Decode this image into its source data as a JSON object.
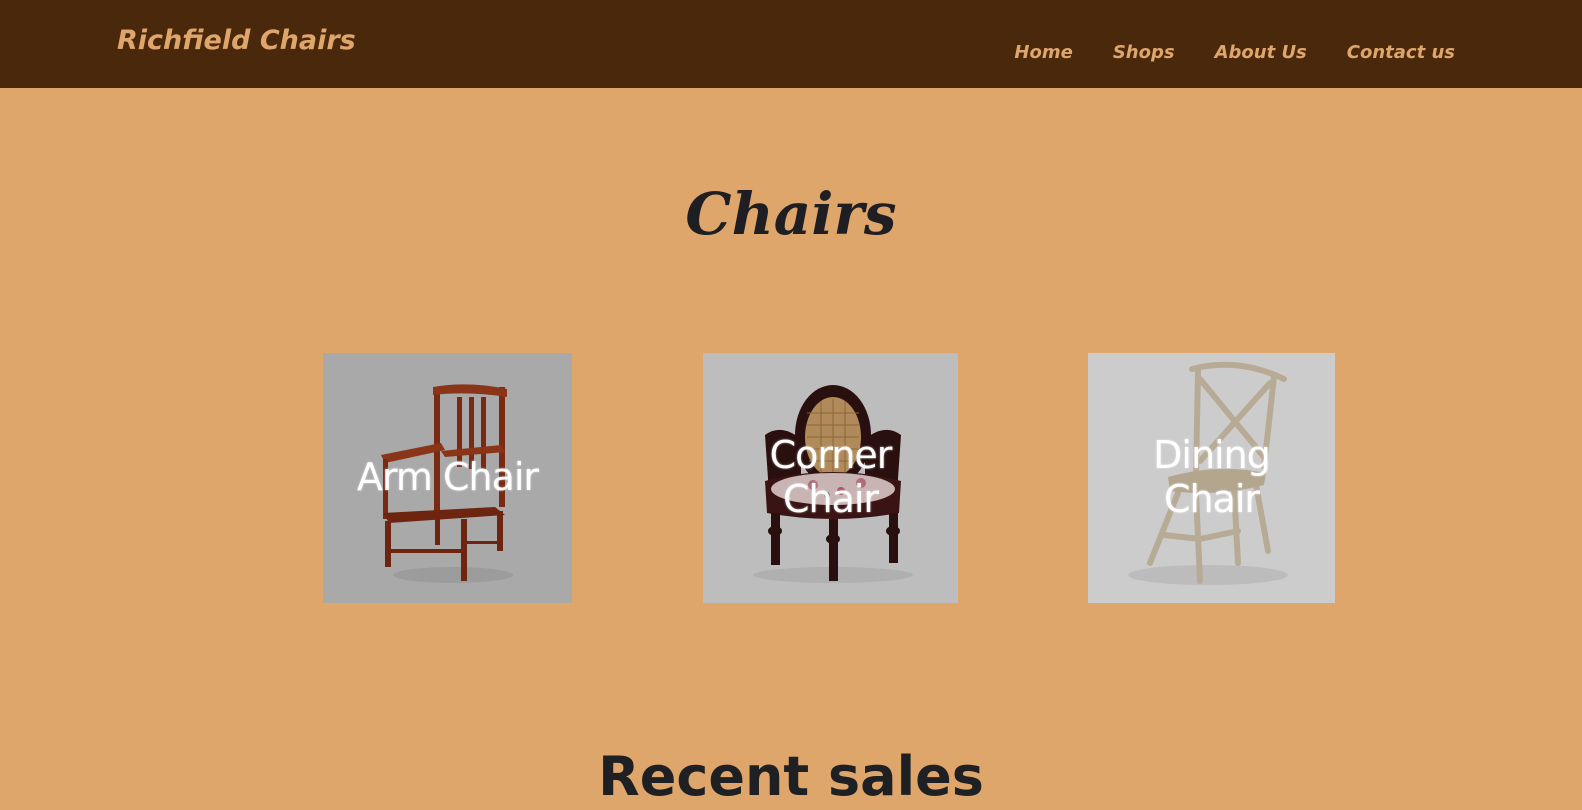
{
  "navbar": {
    "brand": "Richfield Chairs",
    "links": [
      "Home",
      "Shops",
      "About Us",
      "Contact us"
    ]
  },
  "main": {
    "title": "Chairs",
    "cards": [
      {
        "label": "Arm Chair",
        "image": "arm-chair"
      },
      {
        "label": "Corner Chair",
        "image": "corner-chair"
      },
      {
        "label": "Dining Chair",
        "image": "dining-chair"
      }
    ],
    "section_title": "Recent sales"
  },
  "colors": {
    "navbar_bg": "#4a280b",
    "page_bg": "#dfa66b",
    "accent_text": "#dfa66b",
    "heading_text": "#1f1f23"
  }
}
